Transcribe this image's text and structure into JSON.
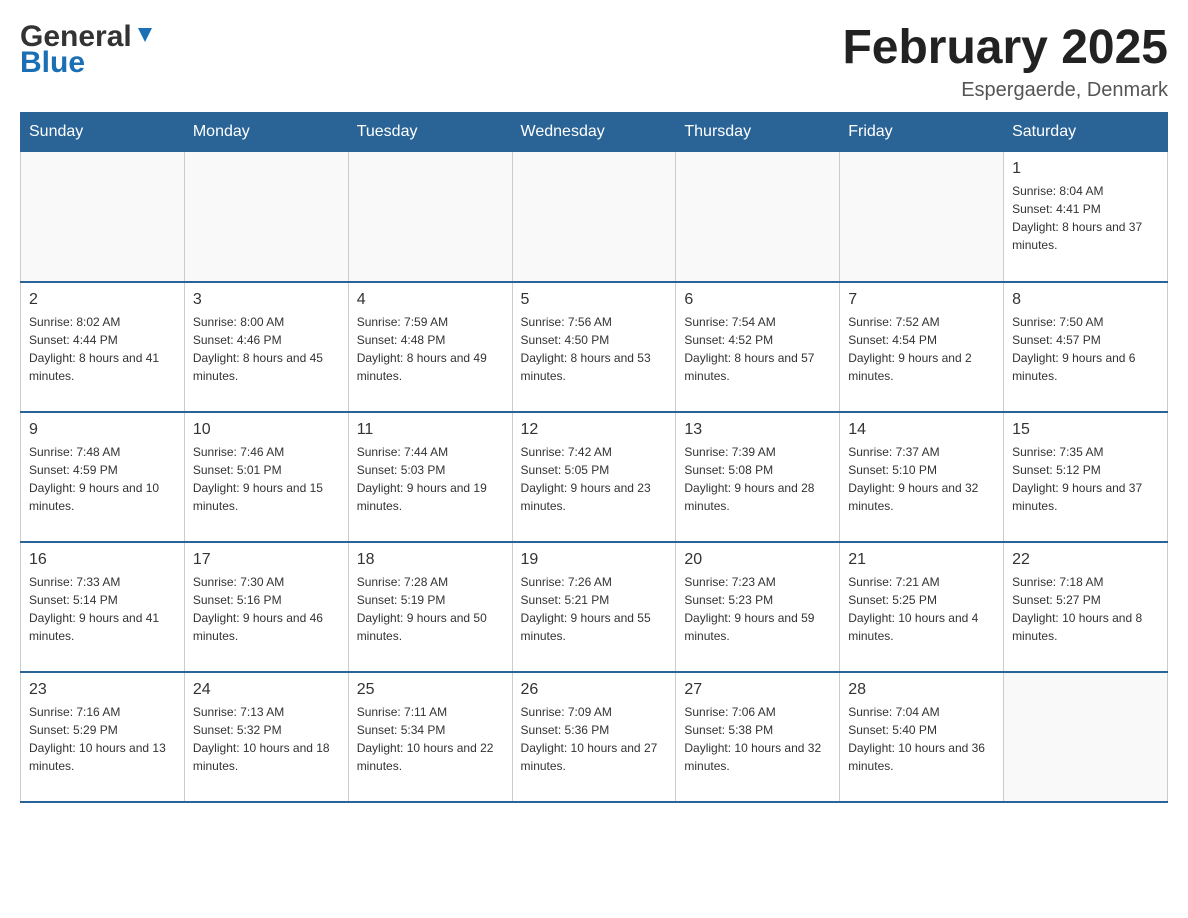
{
  "header": {
    "logo_general": "General",
    "logo_blue": "Blue",
    "month_title": "February 2025",
    "location": "Espergaerde, Denmark"
  },
  "weekdays": [
    "Sunday",
    "Monday",
    "Tuesday",
    "Wednesday",
    "Thursday",
    "Friday",
    "Saturday"
  ],
  "weeks": [
    [
      {
        "day": "",
        "sunrise": "",
        "sunset": "",
        "daylight": ""
      },
      {
        "day": "",
        "sunrise": "",
        "sunset": "",
        "daylight": ""
      },
      {
        "day": "",
        "sunrise": "",
        "sunset": "",
        "daylight": ""
      },
      {
        "day": "",
        "sunrise": "",
        "sunset": "",
        "daylight": ""
      },
      {
        "day": "",
        "sunrise": "",
        "sunset": "",
        "daylight": ""
      },
      {
        "day": "",
        "sunrise": "",
        "sunset": "",
        "daylight": ""
      },
      {
        "day": "1",
        "sunrise": "Sunrise: 8:04 AM",
        "sunset": "Sunset: 4:41 PM",
        "daylight": "Daylight: 8 hours and 37 minutes."
      }
    ],
    [
      {
        "day": "2",
        "sunrise": "Sunrise: 8:02 AM",
        "sunset": "Sunset: 4:44 PM",
        "daylight": "Daylight: 8 hours and 41 minutes."
      },
      {
        "day": "3",
        "sunrise": "Sunrise: 8:00 AM",
        "sunset": "Sunset: 4:46 PM",
        "daylight": "Daylight: 8 hours and 45 minutes."
      },
      {
        "day": "4",
        "sunrise": "Sunrise: 7:59 AM",
        "sunset": "Sunset: 4:48 PM",
        "daylight": "Daylight: 8 hours and 49 minutes."
      },
      {
        "day": "5",
        "sunrise": "Sunrise: 7:56 AM",
        "sunset": "Sunset: 4:50 PM",
        "daylight": "Daylight: 8 hours and 53 minutes."
      },
      {
        "day": "6",
        "sunrise": "Sunrise: 7:54 AM",
        "sunset": "Sunset: 4:52 PM",
        "daylight": "Daylight: 8 hours and 57 minutes."
      },
      {
        "day": "7",
        "sunrise": "Sunrise: 7:52 AM",
        "sunset": "Sunset: 4:54 PM",
        "daylight": "Daylight: 9 hours and 2 minutes."
      },
      {
        "day": "8",
        "sunrise": "Sunrise: 7:50 AM",
        "sunset": "Sunset: 4:57 PM",
        "daylight": "Daylight: 9 hours and 6 minutes."
      }
    ],
    [
      {
        "day": "9",
        "sunrise": "Sunrise: 7:48 AM",
        "sunset": "Sunset: 4:59 PM",
        "daylight": "Daylight: 9 hours and 10 minutes."
      },
      {
        "day": "10",
        "sunrise": "Sunrise: 7:46 AM",
        "sunset": "Sunset: 5:01 PM",
        "daylight": "Daylight: 9 hours and 15 minutes."
      },
      {
        "day": "11",
        "sunrise": "Sunrise: 7:44 AM",
        "sunset": "Sunset: 5:03 PM",
        "daylight": "Daylight: 9 hours and 19 minutes."
      },
      {
        "day": "12",
        "sunrise": "Sunrise: 7:42 AM",
        "sunset": "Sunset: 5:05 PM",
        "daylight": "Daylight: 9 hours and 23 minutes."
      },
      {
        "day": "13",
        "sunrise": "Sunrise: 7:39 AM",
        "sunset": "Sunset: 5:08 PM",
        "daylight": "Daylight: 9 hours and 28 minutes."
      },
      {
        "day": "14",
        "sunrise": "Sunrise: 7:37 AM",
        "sunset": "Sunset: 5:10 PM",
        "daylight": "Daylight: 9 hours and 32 minutes."
      },
      {
        "day": "15",
        "sunrise": "Sunrise: 7:35 AM",
        "sunset": "Sunset: 5:12 PM",
        "daylight": "Daylight: 9 hours and 37 minutes."
      }
    ],
    [
      {
        "day": "16",
        "sunrise": "Sunrise: 7:33 AM",
        "sunset": "Sunset: 5:14 PM",
        "daylight": "Daylight: 9 hours and 41 minutes."
      },
      {
        "day": "17",
        "sunrise": "Sunrise: 7:30 AM",
        "sunset": "Sunset: 5:16 PM",
        "daylight": "Daylight: 9 hours and 46 minutes."
      },
      {
        "day": "18",
        "sunrise": "Sunrise: 7:28 AM",
        "sunset": "Sunset: 5:19 PM",
        "daylight": "Daylight: 9 hours and 50 minutes."
      },
      {
        "day": "19",
        "sunrise": "Sunrise: 7:26 AM",
        "sunset": "Sunset: 5:21 PM",
        "daylight": "Daylight: 9 hours and 55 minutes."
      },
      {
        "day": "20",
        "sunrise": "Sunrise: 7:23 AM",
        "sunset": "Sunset: 5:23 PM",
        "daylight": "Daylight: 9 hours and 59 minutes."
      },
      {
        "day": "21",
        "sunrise": "Sunrise: 7:21 AM",
        "sunset": "Sunset: 5:25 PM",
        "daylight": "Daylight: 10 hours and 4 minutes."
      },
      {
        "day": "22",
        "sunrise": "Sunrise: 7:18 AM",
        "sunset": "Sunset: 5:27 PM",
        "daylight": "Daylight: 10 hours and 8 minutes."
      }
    ],
    [
      {
        "day": "23",
        "sunrise": "Sunrise: 7:16 AM",
        "sunset": "Sunset: 5:29 PM",
        "daylight": "Daylight: 10 hours and 13 minutes."
      },
      {
        "day": "24",
        "sunrise": "Sunrise: 7:13 AM",
        "sunset": "Sunset: 5:32 PM",
        "daylight": "Daylight: 10 hours and 18 minutes."
      },
      {
        "day": "25",
        "sunrise": "Sunrise: 7:11 AM",
        "sunset": "Sunset: 5:34 PM",
        "daylight": "Daylight: 10 hours and 22 minutes."
      },
      {
        "day": "26",
        "sunrise": "Sunrise: 7:09 AM",
        "sunset": "Sunset: 5:36 PM",
        "daylight": "Daylight: 10 hours and 27 minutes."
      },
      {
        "day": "27",
        "sunrise": "Sunrise: 7:06 AM",
        "sunset": "Sunset: 5:38 PM",
        "daylight": "Daylight: 10 hours and 32 minutes."
      },
      {
        "day": "28",
        "sunrise": "Sunrise: 7:04 AM",
        "sunset": "Sunset: 5:40 PM",
        "daylight": "Daylight: 10 hours and 36 minutes."
      },
      {
        "day": "",
        "sunrise": "",
        "sunset": "",
        "daylight": ""
      }
    ]
  ]
}
